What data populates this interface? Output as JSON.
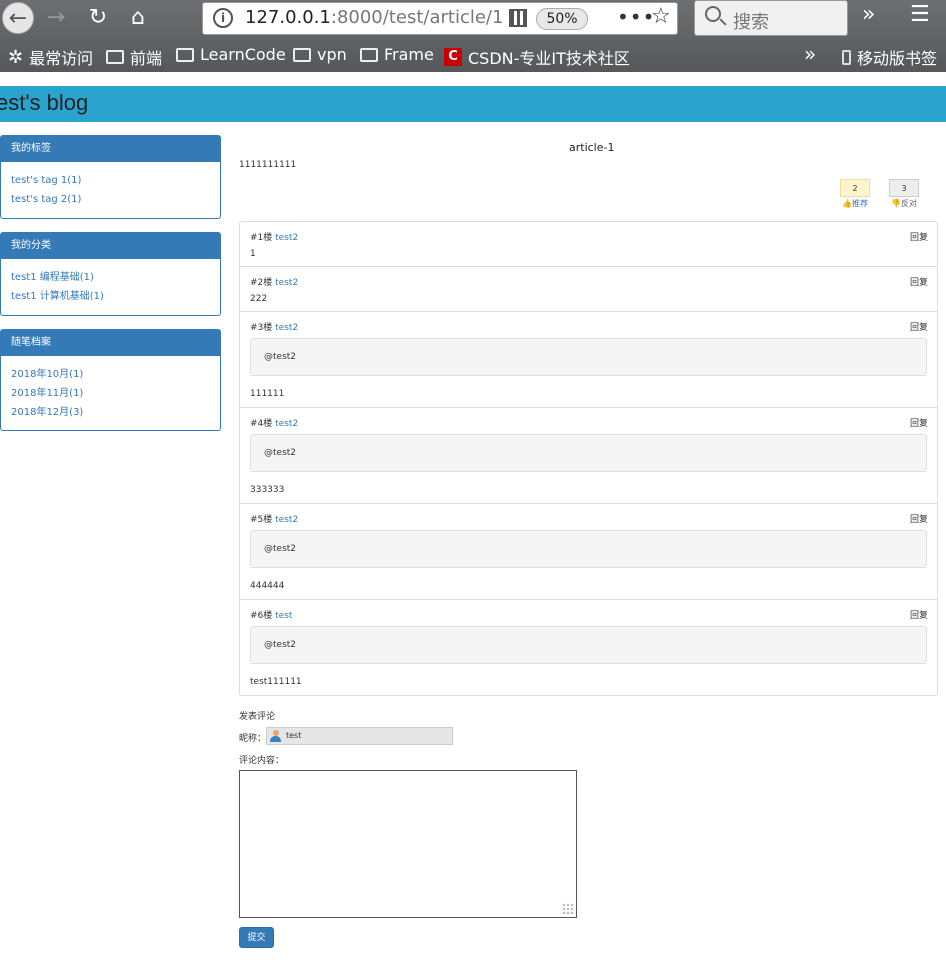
{
  "browser": {
    "url_host": "127.0.0.1",
    "url_rest": ":8000/test/article/1",
    "zoom": "50%",
    "search_placeholder": "搜索",
    "bookmarks": [
      "最常访问",
      "前端",
      "LearnCode",
      "vpn",
      "Frame",
      "CSDN-专业IT技术社区"
    ],
    "mobile_bookmarks": "移动版书签"
  },
  "blog": {
    "title": "est's blog"
  },
  "sidebar": {
    "tags": {
      "title": "我的标签",
      "items": [
        "test's tag 1(1)",
        "test's tag 2(1)"
      ]
    },
    "categories": {
      "title": "我的分类",
      "items": [
        "test1 编程基础(1)",
        "test1 计算机基础(1)"
      ]
    },
    "archive": {
      "title": "随笔档案",
      "items": [
        "2018年10月(1)",
        "2018年11月(1)",
        "2018年12月(3)"
      ]
    }
  },
  "article": {
    "title": "article-1",
    "body": "1111111111",
    "up_count": "2",
    "up_label": "推荐",
    "down_count": "3",
    "down_label": "反对"
  },
  "comments": [
    {
      "floor": "#1楼",
      "user": "test2",
      "reply": "回复",
      "quote": "",
      "text": "1"
    },
    {
      "floor": "#2楼",
      "user": "test2",
      "reply": "回复",
      "quote": "",
      "text": "222"
    },
    {
      "floor": "#3楼",
      "user": "test2",
      "reply": "回复",
      "quote": "@test2",
      "text": "111111"
    },
    {
      "floor": "#4楼",
      "user": "test2",
      "reply": "回复",
      "quote": "@test2",
      "text": "333333"
    },
    {
      "floor": "#5楼",
      "user": "test2",
      "reply": "回复",
      "quote": "@test2",
      "text": "444444"
    },
    {
      "floor": "#6楼",
      "user": "test",
      "reply": "回复",
      "quote": "@test2",
      "text": "test111111"
    }
  ],
  "form": {
    "title": "发表评论",
    "nick_label": "昵称：",
    "nick_value": "test",
    "content_label": "评论内容：",
    "submit": "提交"
  }
}
